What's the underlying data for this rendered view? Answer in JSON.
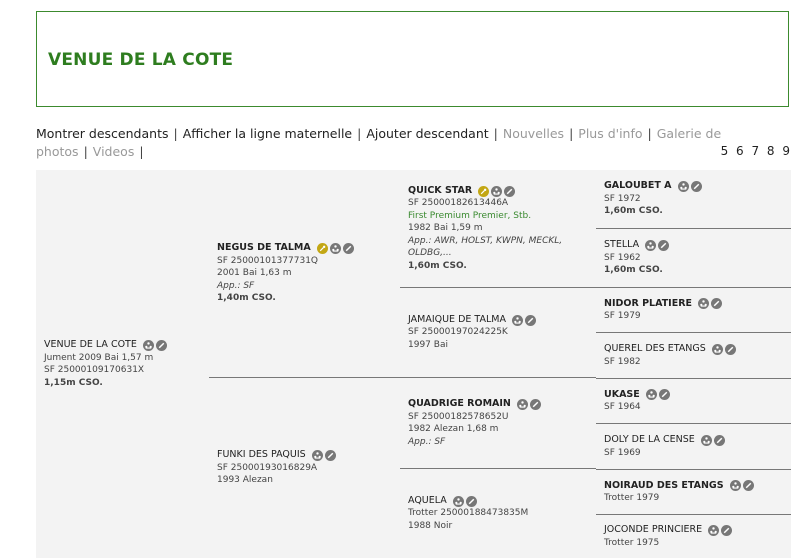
{
  "title": "VENUE DE LA COTE",
  "nav": {
    "items": [
      {
        "label": "Montrer descendants",
        "enabled": true
      },
      {
        "label": "Afficher la ligne maternelle",
        "enabled": true
      },
      {
        "label": "Ajouter descendant",
        "enabled": true
      },
      {
        "label": "Nouvelles",
        "enabled": false
      },
      {
        "label": "Plus d'info",
        "enabled": false
      },
      {
        "label": "Galerie de photos",
        "enabled": false
      },
      {
        "label": "Videos",
        "enabled": false
      }
    ],
    "pages": "5 6 7 8 9"
  },
  "colors": {
    "accent": "#2e7d1f",
    "gold": "#c3a714",
    "icon": "#777777",
    "grid_bg": "#f3f3f3"
  },
  "pedigree": {
    "subject": {
      "name": "VENUE DE LA COTE",
      "lines": [
        "Jument 2009 Bai 1,57 m",
        "SF 25000109170631X",
        "1,15m CSO."
      ]
    },
    "sire": {
      "name": "NEGUS DE TALMA",
      "lines": [
        "SF 25000101377731Q",
        "2001 Bai 1,63 m",
        "App.: SF",
        "1,40m CSO."
      ]
    },
    "dam": {
      "name": "FUNKI DES PAQUIS",
      "lines": [
        "SF 25000193016829A",
        "1993 Alezan"
      ]
    },
    "ss": {
      "name": "QUICK STAR",
      "lines": [
        "SF 25000182613446A",
        "First Premium Premier, Stb.",
        "1982 Bai 1,59 m",
        "App.: AWR, HOLST, KWPN, MECKL, OLDBG,...",
        "1,60m CSO."
      ]
    },
    "sd": {
      "name": "JAMAIQUE DE TALMA",
      "lines": [
        "SF 25000197024225K",
        "1997 Bai"
      ]
    },
    "ds": {
      "name": "QUADRIGE ROMAIN",
      "lines": [
        "SF 25000182578652U",
        "1982 Alezan 1,68 m",
        "App.: SF"
      ]
    },
    "dd": {
      "name": "AQUELA",
      "lines": [
        "Trotter 25000188473835M",
        "1988 Noir"
      ]
    },
    "g": [
      {
        "name": "GALOUBET A",
        "lines": [
          "SF 1972",
          "1,60m CSO."
        ]
      },
      {
        "name": "STELLA",
        "lines": [
          "SF 1962",
          "1,60m CSO."
        ]
      },
      {
        "name": "NIDOR PLATIERE",
        "lines": [
          "SF 1979"
        ]
      },
      {
        "name": "QUEREL DES ETANGS",
        "lines": [
          "SF 1982"
        ]
      },
      {
        "name": "UKASE",
        "lines": [
          "SF 1964"
        ]
      },
      {
        "name": "DOLY DE LA CENSE",
        "lines": [
          "SF 1969"
        ]
      },
      {
        "name": "NOIRAUD DES ETANGS",
        "lines": [
          "Trotter 1979"
        ]
      },
      {
        "name": "JOCONDE PRINCIERE",
        "lines": [
          "Trotter 1975"
        ]
      }
    ]
  }
}
